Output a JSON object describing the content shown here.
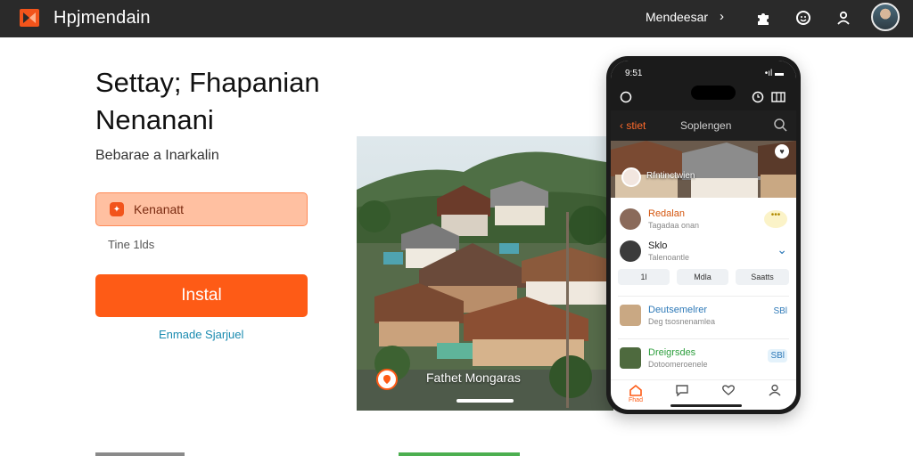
{
  "topbar": {
    "brand": "Hpjmendain",
    "link_label": "Mendeesar",
    "chevron": "›",
    "icons": [
      "puzzle-icon",
      "smiley-icon",
      "person-icon"
    ],
    "avatar": "user-avatar"
  },
  "hero": {
    "title_line1": "Settay; Fhapanian",
    "title_line2": "Nenanani",
    "subtitle": "Bebarae a Inarkalin",
    "promo_text": "Kenanatt",
    "small_label": "Tine 1lds",
    "install_label": "Instal",
    "secondary_link": "Enmade Sjarjuel"
  },
  "photo": {
    "caption": "Fathet Mongaras"
  },
  "phone": {
    "status_time": "9:51",
    "status_right": "•ıl ▬",
    "header_left": "‹ stiet",
    "header_center": "Soplengen",
    "photo_label": "Rfntinctwien",
    "feed": [
      {
        "title": "Redalan",
        "sub": "Tagadaa onan",
        "title_color": "#d4560f",
        "action": "•••"
      },
      {
        "title": "Sklo",
        "sub": "Talenoantle",
        "title_color": "#1d1d1d",
        "action": "⌄"
      },
      {
        "title": "Deutsemelrer",
        "sub": "Deg tsosnenamlea",
        "title_color": "#2f7ab8",
        "action": "SBl"
      },
      {
        "title": "Dreigrsdes",
        "sub": "Dotoomeroenele",
        "title_color": "#2e9f3e",
        "action": "SBl"
      }
    ],
    "chips": [
      "1l",
      "Mdla",
      "Saatts"
    ],
    "tab_label": "Fhad"
  },
  "colors": {
    "accent": "#fe5b16",
    "topbar": "#2a2a2a",
    "promo_bg": "#ffc0a1",
    "link": "#1a8bb0"
  }
}
